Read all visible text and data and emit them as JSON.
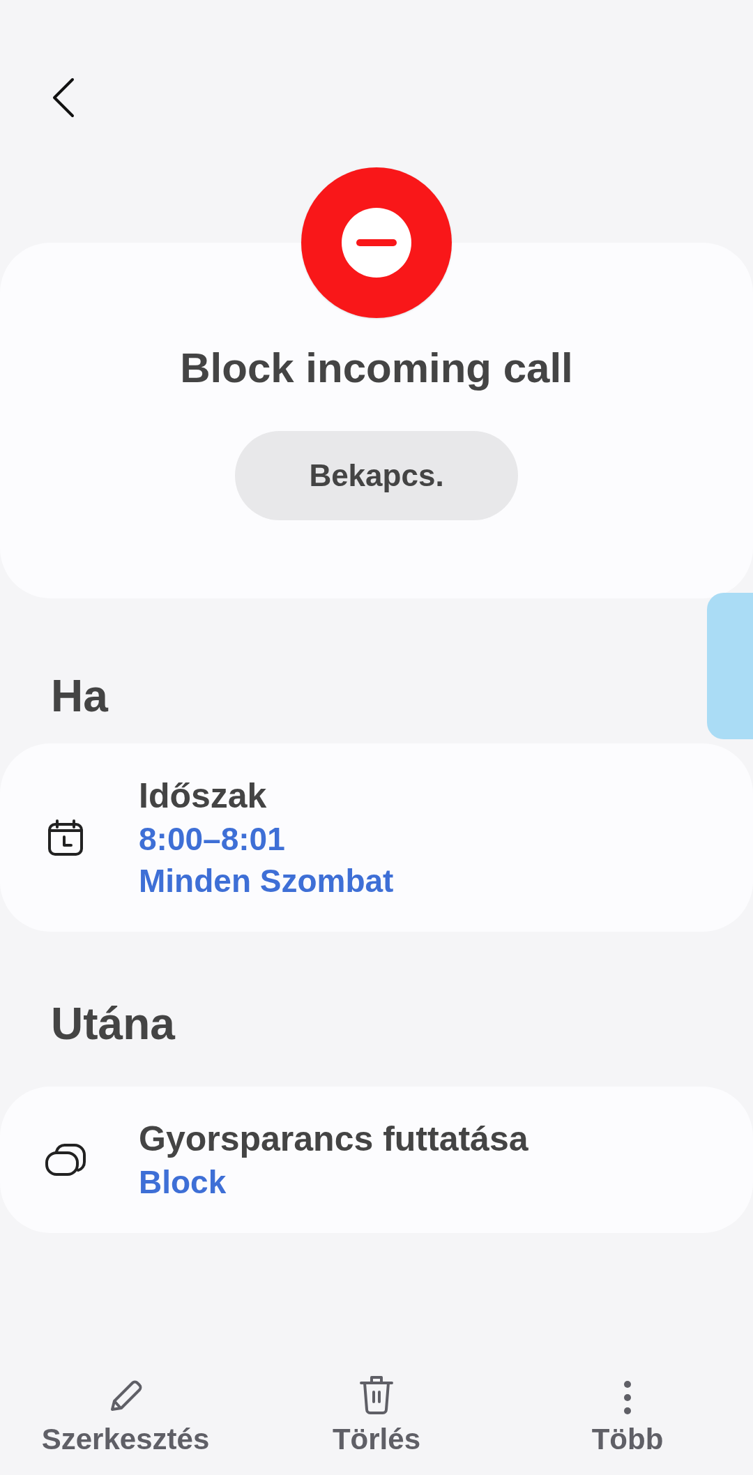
{
  "header": {
    "title": "Block incoming call",
    "toggle_button": "Bekapcs."
  },
  "sections": [
    {
      "heading": "Ha",
      "items": [
        {
          "kind": "calendar",
          "title": "Időszak",
          "details": [
            "8:00–8:01",
            "Minden Szombat"
          ]
        }
      ]
    },
    {
      "heading": "Utána",
      "items": [
        {
          "kind": "shortcut",
          "title": "Gyorsparancs futtatása",
          "details": [
            "Block"
          ]
        }
      ]
    }
  ],
  "bottom_bar": [
    {
      "kind": "edit",
      "label": "Szerkesztés"
    },
    {
      "kind": "delete",
      "label": "Törlés"
    },
    {
      "kind": "more",
      "label": "Több"
    }
  ]
}
